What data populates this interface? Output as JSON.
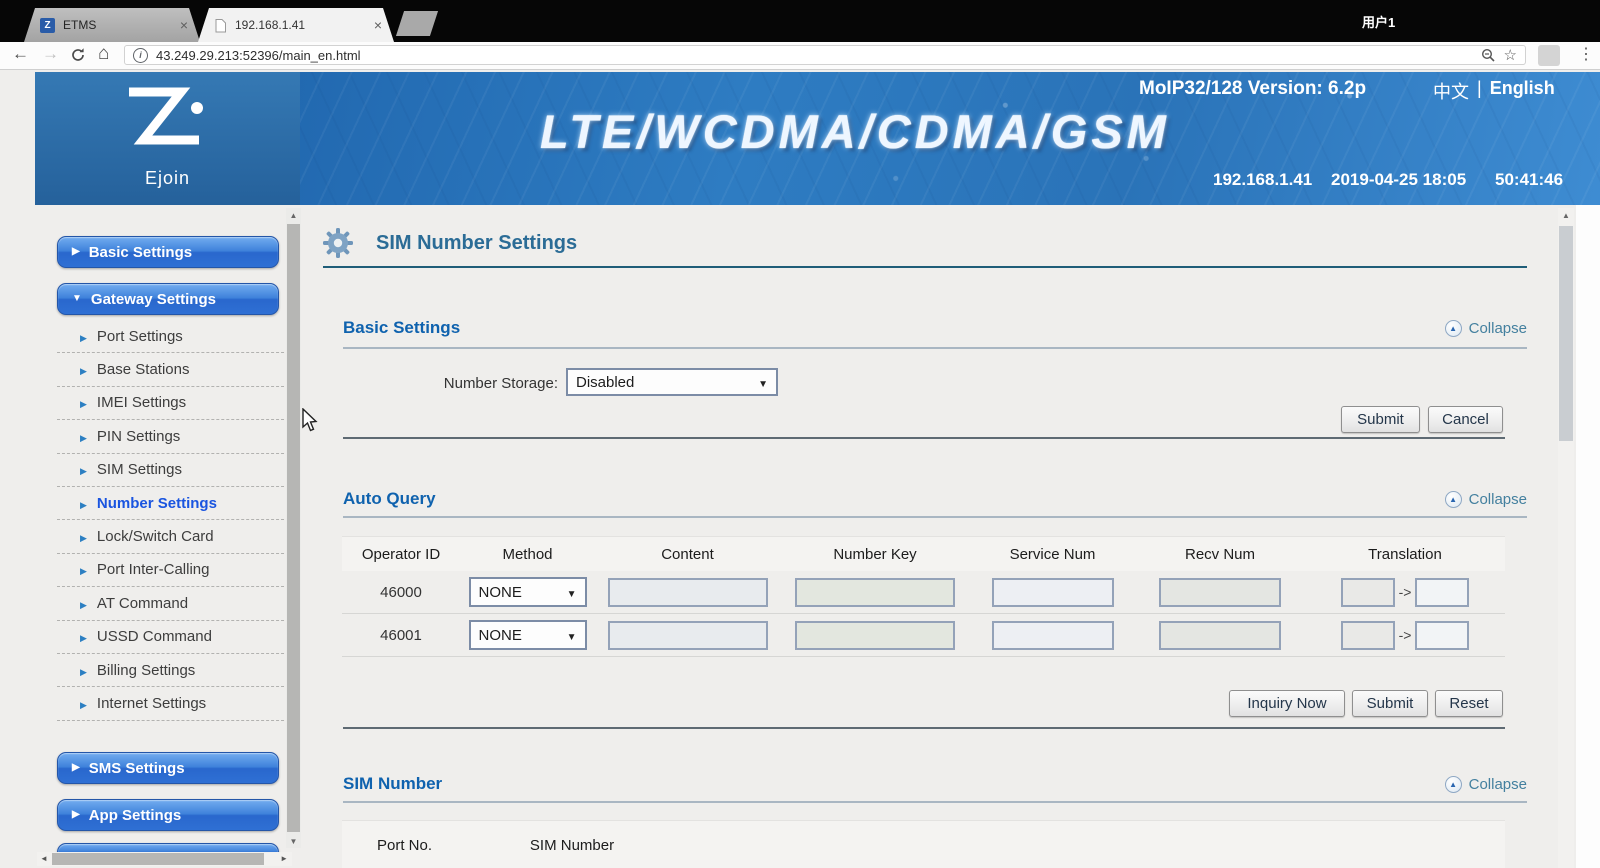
{
  "browser": {
    "tab1": "ETMS",
    "tab2": "192.168.1.41",
    "user": "用户1",
    "url": "43.249.29.213:52396/main_en.html"
  },
  "header": {
    "product": "MoIP32/128 Version: 6.2p",
    "lang_zh": "中文",
    "lang_sep": "|",
    "lang_en": "English",
    "banner_title": "LTE/WCDMA/CDMA/GSM",
    "ip": "192.168.1.41",
    "datetime": "2019-04-25 18:05",
    "uptime": "50:41:46",
    "logo": "Ejoin"
  },
  "sidebar": {
    "group_basic": "Basic Settings",
    "group_gateway": "Gateway Settings",
    "group_sms": "SMS Settings",
    "group_app": "App Settings",
    "items": [
      "Port Settings",
      "Base Stations",
      "IMEI Settings",
      "PIN Settings",
      "SIM Settings",
      "Number Settings",
      "Lock/Switch Card",
      "Port Inter-Calling",
      "AT Command",
      "USSD Command",
      "Billing Settings",
      "Internet Settings"
    ]
  },
  "main": {
    "title": "SIM Number Settings",
    "collapse": "Collapse",
    "basic": {
      "heading": "Basic Settings",
      "storage_label": "Number Storage:",
      "storage_value": "Disabled",
      "submit": "Submit",
      "cancel": "Cancel"
    },
    "query": {
      "heading": "Auto Query",
      "cols": [
        "Operator ID",
        "Method",
        "Content",
        "Number Key",
        "Service Num",
        "Recv Num",
        "Translation"
      ],
      "rows": [
        {
          "id": "46000",
          "method": "NONE"
        },
        {
          "id": "46001",
          "method": "NONE"
        }
      ],
      "arrow": "->",
      "inquiry": "Inquiry Now",
      "submit": "Submit",
      "reset": "Reset"
    },
    "sim": {
      "heading": "SIM Number",
      "col_port": "Port No.",
      "col_sim": "SIM Number"
    }
  }
}
